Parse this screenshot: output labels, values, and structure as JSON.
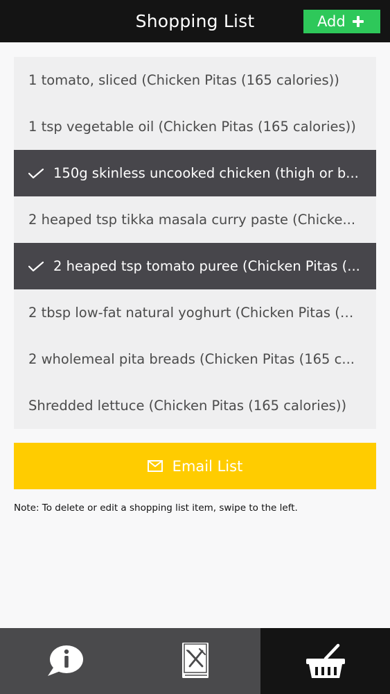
{
  "header": {
    "title": "Shopping List",
    "add_label": "Add"
  },
  "items": [
    {
      "text": "1 tomato, sliced (Chicken Pitas (165 calories))",
      "checked": false
    },
    {
      "text": "1 tsp vegetable oil (Chicken Pitas (165 calories))",
      "checked": false
    },
    {
      "text": "150g skinless uncooked chicken (thigh or b...",
      "checked": true
    },
    {
      "text": "2 heaped tsp tikka masala curry paste (Chicke...",
      "checked": false
    },
    {
      "text": "2 heaped tsp tomato puree (Chicken Pitas (...",
      "checked": true
    },
    {
      "text": "2 tbsp low-fat natural yoghurt (Chicken Pitas (1...",
      "checked": false
    },
    {
      "text": "2 wholemeal pita breads (Chicken Pitas (165 c...",
      "checked": false
    },
    {
      "text": "Shredded lettuce (Chicken Pitas (165 calories))",
      "checked": false
    }
  ],
  "email_button": {
    "label": "Email List",
    "icon": "mail-icon"
  },
  "note": "Note: To delete or edit a shopping list item, swipe to the left.",
  "tabs": [
    {
      "name": "info",
      "icon": "info-icon",
      "active": false
    },
    {
      "name": "recipes",
      "icon": "recipe-book-icon",
      "active": false
    },
    {
      "name": "shopping",
      "icon": "basket-icon",
      "active": true
    }
  ],
  "colors": {
    "header_bg": "#141414",
    "add_green": "#2ec85a",
    "checked_bg": "#47464b",
    "email_yellow": "#ffcc00",
    "tab_bg": "#4a4a4c",
    "tab_active_bg": "#141414"
  }
}
